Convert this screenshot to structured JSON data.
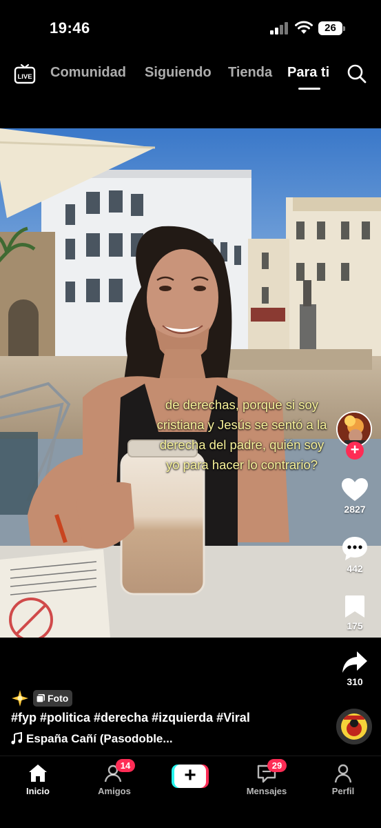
{
  "status_bar": {
    "time": "19:46",
    "battery": "26"
  },
  "top_nav": {
    "tabs": [
      {
        "label": "Comunidad"
      },
      {
        "label": "Siguiendo"
      },
      {
        "label": "Tienda"
      },
      {
        "label": "Para ti",
        "active": true
      }
    ]
  },
  "video": {
    "caption_lines": [
      "de derechas, porque si soy",
      "cristiana y Jesús se sentó a la",
      "derecha del padre, quién soy",
      "yo para hacer lo contrario?"
    ]
  },
  "right_rail": {
    "likes": "2827",
    "comments": "442",
    "saves": "175",
    "shares": "310"
  },
  "post": {
    "badge_label": "Foto",
    "hashtags": "#fyp #politica #derecha #izquierda #Viral",
    "sound": "España Cañí (Pasodoble..."
  },
  "tab_bar": {
    "items": [
      {
        "label": "Inicio"
      },
      {
        "label": "Amigos",
        "badge": "14"
      },
      {
        "label": "Mensajes",
        "badge": "29"
      },
      {
        "label": "Perfil"
      }
    ]
  },
  "colors": {
    "accent": "#fe2c55",
    "accent_cyan": "#25f4ee",
    "caption": "#f7f29a"
  }
}
